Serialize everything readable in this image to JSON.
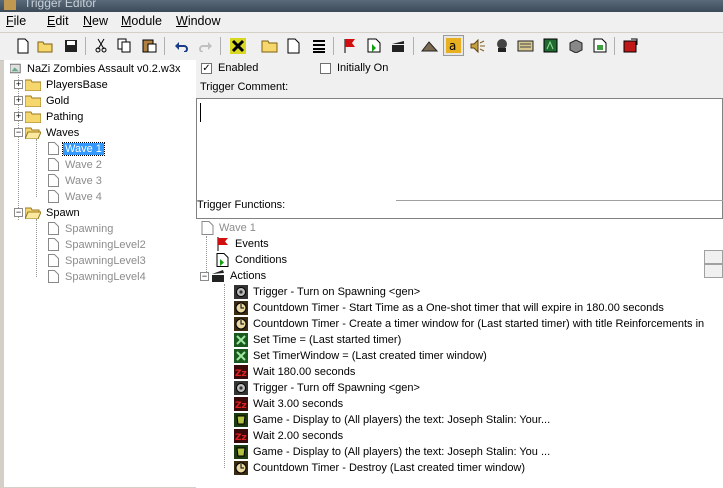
{
  "window": {
    "title": "Trigger Editor"
  },
  "menu": [
    "File",
    "Edit",
    "New",
    "Module",
    "Window"
  ],
  "menu_underline": [
    "F",
    "E",
    "N",
    "M",
    "W"
  ],
  "toolbar_icons": [
    "new-icon",
    "open-icon",
    "save-icon",
    "cut-icon",
    "copy-icon",
    "paste-icon",
    "undo-icon",
    "redo-icon",
    "delete-icon",
    "new-category-icon",
    "new-trigger-icon",
    "new-comment-icon",
    "new-event-icon",
    "new-condition-icon",
    "new-action-icon",
    "terrain-editor-icon",
    "trigger-editor-icon",
    "sound-editor-icon",
    "object-editor-icon",
    "campaign-editor-icon",
    "ai-editor-icon",
    "object-manager-icon",
    "import-manager-icon",
    "test-map-icon"
  ],
  "tree": {
    "root": "NaZi Zombies Assault v0.2.w3x",
    "categories": [
      {
        "label": "PlayersBase"
      },
      {
        "label": "Gold"
      },
      {
        "label": "Pathing"
      },
      {
        "label": "Waves",
        "children": [
          "Wave 1",
          "Wave 2",
          "Wave 3",
          "Wave 4"
        ],
        "selected": "Wave 1"
      },
      {
        "label": "Spawn",
        "children": [
          "Spawning",
          "SpawningLevel2",
          "SpawningLevel3",
          "SpawningLevel4"
        ]
      }
    ]
  },
  "editor": {
    "enabled_label": "Enabled",
    "enabled_checked": true,
    "initially_on_label": "Initially On",
    "initially_on_checked": false,
    "comment_label": "Trigger Comment:",
    "comment_text": "",
    "functions_label": "Trigger Functions:"
  },
  "functions": {
    "trigger_name": "Wave 1",
    "events_label": "Events",
    "conditions_label": "Conditions",
    "actions_label": "Actions",
    "actions": [
      {
        "icon": "trigger-gear-icon",
        "text": "Trigger - Turn on Spawning <gen>"
      },
      {
        "icon": "timer-icon",
        "text": "Countdown Timer - Start Time as a One-shot timer that will expire in 180.00 seconds"
      },
      {
        "icon": "timer-icon",
        "text": "Countdown Timer - Create a timer window for (Last started timer) with title Reinforcements in"
      },
      {
        "icon": "set-variable-icon",
        "text": "Set Time = (Last started timer)"
      },
      {
        "icon": "set-variable-icon",
        "text": "Set TimerWindow = (Last created timer window)"
      },
      {
        "icon": "wait-icon",
        "text": "Wait 180.00 seconds"
      },
      {
        "icon": "trigger-gear-icon",
        "text": "Trigger - Turn off Spawning <gen>"
      },
      {
        "icon": "wait-icon",
        "text": "Wait 3.00 seconds"
      },
      {
        "icon": "game-icon",
        "text": "Game - Display to (All players) the text: Joseph Stalin: Your..."
      },
      {
        "icon": "wait-icon",
        "text": "Wait 2.00 seconds"
      },
      {
        "icon": "game-icon",
        "text": "Game - Display to (All players) the text: Joseph Stalin: You ..."
      },
      {
        "icon": "timer-icon",
        "text": "Countdown Timer - Destroy (Last created timer window)"
      }
    ]
  },
  "colors": {
    "selection": "#3399ff",
    "disabled_text": "#8c8c8c",
    "folder": "#f5d76e"
  }
}
